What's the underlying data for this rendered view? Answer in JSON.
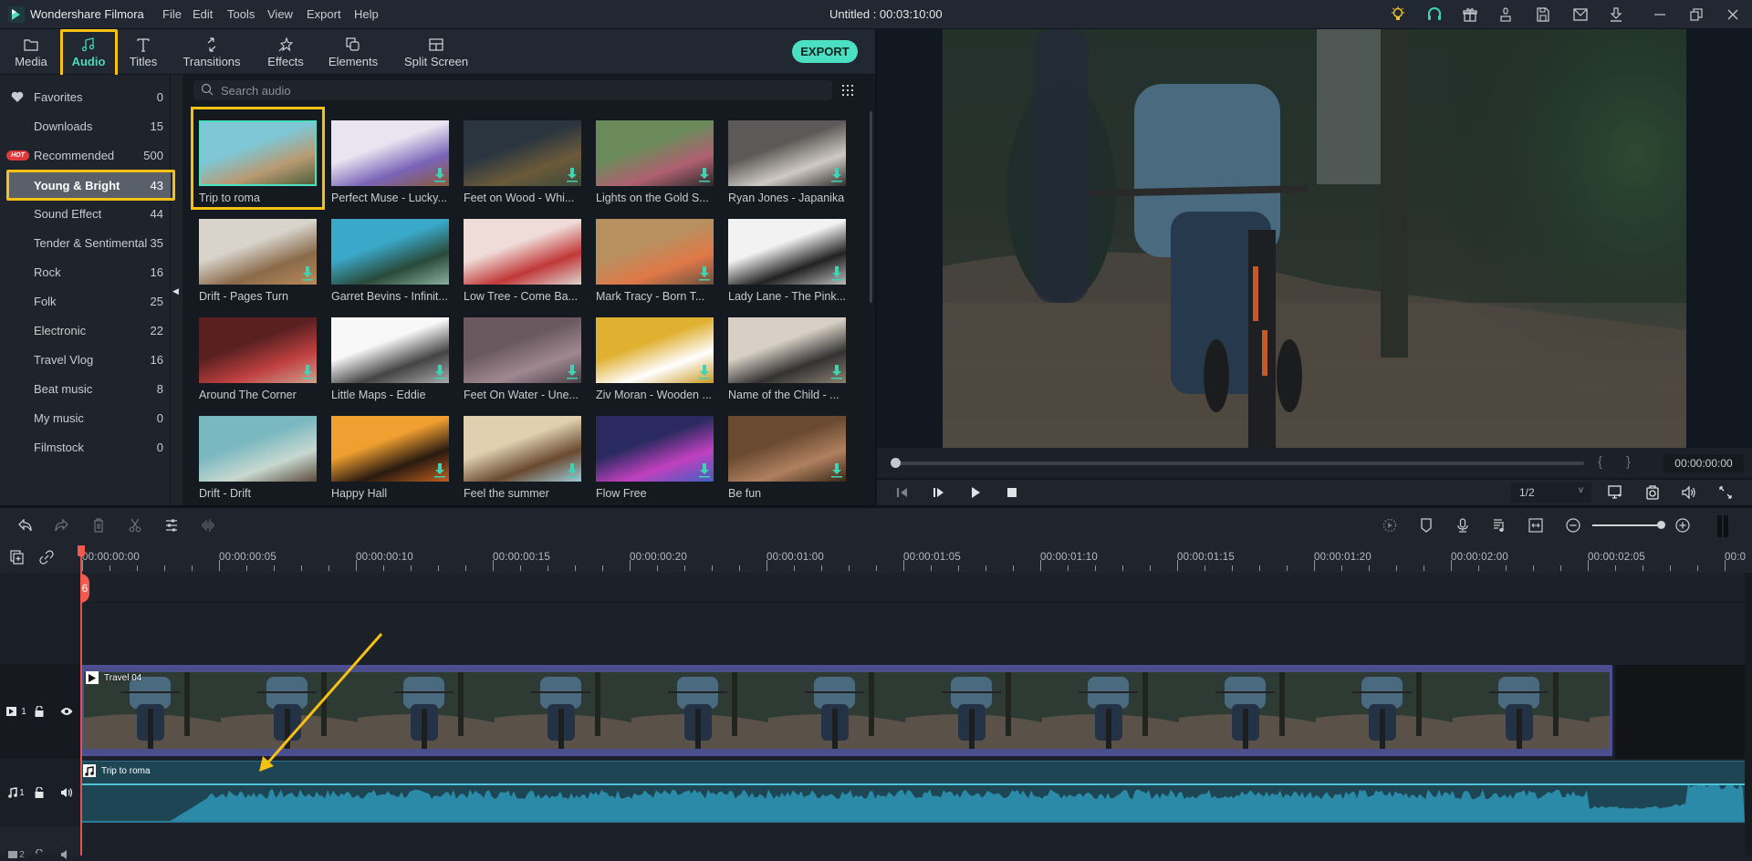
{
  "app": {
    "name": "Wondershare Filmora",
    "document_title": "Untitled : 00:03:10:00",
    "menu": [
      "File",
      "Edit",
      "Tools",
      "View",
      "Export",
      "Help"
    ],
    "toolbar_icons": [
      "lightbulb-icon",
      "headset-icon",
      "gift-icon",
      "account-icon",
      "save-icon",
      "mail-icon",
      "download-icon"
    ],
    "window_controls": [
      "minimize",
      "restore",
      "close"
    ]
  },
  "tabs": [
    {
      "label": "Media",
      "icon": "folder-icon",
      "active": false
    },
    {
      "label": "Audio",
      "icon": "music-note-icon",
      "active": true
    },
    {
      "label": "Titles",
      "icon": "text-icon",
      "active": false
    },
    {
      "label": "Transitions",
      "icon": "transition-icon",
      "active": false
    },
    {
      "label": "Effects",
      "icon": "sparkle-icon",
      "active": false
    },
    {
      "label": "Elements",
      "icon": "elements-icon",
      "active": false
    },
    {
      "label": "Split Screen",
      "icon": "split-screen-icon",
      "active": false
    }
  ],
  "export_label": "EXPORT",
  "categories": [
    {
      "label": "Favorites",
      "count": "0",
      "icon": "heart-icon"
    },
    {
      "label": "Downloads",
      "count": "15"
    },
    {
      "label": "Recommended",
      "count": "500",
      "badge": "HOT"
    },
    {
      "label": "Young & Bright",
      "count": "43",
      "selected": true
    },
    {
      "label": "Sound Effect",
      "count": "44"
    },
    {
      "label": "Tender & Sentimental",
      "count": "35"
    },
    {
      "label": "Rock",
      "count": "16"
    },
    {
      "label": "Folk",
      "count": "25"
    },
    {
      "label": "Electronic",
      "count": "22"
    },
    {
      "label": "Travel Vlog",
      "count": "16"
    },
    {
      "label": "Beat music",
      "count": "8"
    },
    {
      "label": "My music",
      "count": "0"
    },
    {
      "label": "Filmstock",
      "count": "0"
    }
  ],
  "search": {
    "placeholder": "Search audio",
    "value": ""
  },
  "audio_items": [
    {
      "name": "Trip to roma",
      "downloaded": true,
      "selected": true
    },
    {
      "name": "Perfect Muse - Lucky...",
      "downloaded": false
    },
    {
      "name": "Feet on Wood - Whi...",
      "downloaded": false
    },
    {
      "name": "Lights on the Gold S...",
      "downloaded": false
    },
    {
      "name": "Ryan Jones - Japanika",
      "downloaded": false
    },
    {
      "name": "Drift - Pages Turn",
      "downloaded": false
    },
    {
      "name": "Garret Bevins - Infinit...",
      "downloaded": true
    },
    {
      "name": "Low Tree - Come Ba...",
      "downloaded": true
    },
    {
      "name": "Mark Tracy - Born T...",
      "downloaded": false
    },
    {
      "name": "Lady Lane - The Pink...",
      "downloaded": false
    },
    {
      "name": "Around The Corner",
      "downloaded": false
    },
    {
      "name": "Little Maps - Eddie",
      "downloaded": false
    },
    {
      "name": "Feet On Water - Une...",
      "downloaded": false
    },
    {
      "name": "Ziv Moran - Wooden ...",
      "downloaded": false
    },
    {
      "name": "Name of the Child - ...",
      "downloaded": false
    },
    {
      "name": "Drift - Drift",
      "downloaded": true
    },
    {
      "name": "Happy Hall",
      "downloaded": false
    },
    {
      "name": "Feel the summer",
      "downloaded": false
    },
    {
      "name": "Flow Free",
      "downloaded": false
    },
    {
      "name": "Be fun",
      "downloaded": false
    }
  ],
  "preview": {
    "current_time": "00:00:00:00",
    "progress": 0,
    "mark_in": "{",
    "mark_out": "}",
    "quality": "1/2"
  },
  "timeline": {
    "ruler_labels": [
      "00:00:00:00",
      "00:00:00:05",
      "00:00:00:10",
      "00:00:00:15",
      "00:00:00:20",
      "00:00:01:00",
      "00:00:01:05",
      "00:00:01:10",
      "00:00:01:15",
      "00:00:01:20",
      "00:00:02:00",
      "00:00:02:05",
      "00:0"
    ],
    "zoom_level": 1.0,
    "video_clip": {
      "name": "Travel 04"
    },
    "audio_clip": {
      "name": "Trip to roma"
    },
    "tracks": [
      {
        "type": "video",
        "number": "1"
      },
      {
        "type": "audio",
        "number": "1"
      },
      {
        "type": "audio",
        "number": "2"
      }
    ]
  },
  "colors": {
    "accent": "#4be0c1",
    "highlight": "#f7c114",
    "playhead": "#f05a4f",
    "video_clip": "#4c4f94",
    "audio_clip": "#2a8aa8"
  }
}
